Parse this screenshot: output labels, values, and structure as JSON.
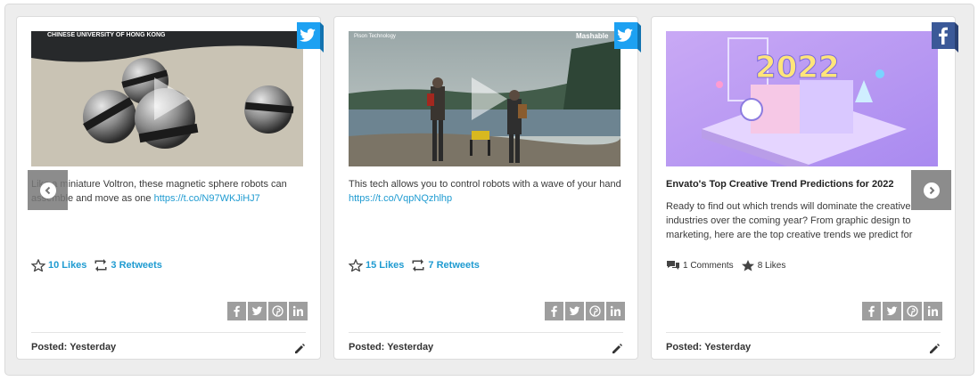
{
  "colors": {
    "link": "#1f9bd1",
    "twitter": "#1da1f2",
    "facebook": "#3b5998",
    "share_bg": "#9e9e9e"
  },
  "cards": [
    {
      "network": "twitter",
      "media_caption": "CHINESE UNIVERSITY OF HONG KONG",
      "text": "Like a miniature Voltron, these magnetic sphere robots can assemble and move as one",
      "link": "https://t.co/N97WKJiHJ7",
      "likes": "10 Likes",
      "retweets": "3 Retweets",
      "posted": "Posted: Yesterday"
    },
    {
      "network": "twitter",
      "media_caption_left": "Pison Technology",
      "media_caption_right": "Mashable",
      "text": "This tech allows you to control robots with a wave of your hand",
      "link": "https://t.co/VqpNQzhlhp",
      "likes": "15 Likes",
      "retweets": "7 Retweets",
      "posted": "Posted: Yesterday"
    },
    {
      "network": "facebook",
      "image_text": "2022",
      "headline": "Envato's Top Creative Trend Predictions for 2022",
      "text": "Ready to find out which trends will dominate the creative industries over the coming year? From graphic design to marketing, here are the top creative trends we predict for",
      "comments": "1 Comments",
      "likes": "8 Likes",
      "posted": "Posted: Yesterday"
    }
  ],
  "icons": {
    "share": [
      "facebook-icon",
      "twitter-icon",
      "pinterest-icon",
      "linkedin-icon"
    ],
    "prev": "chevron-left-icon",
    "next": "chevron-right-icon"
  }
}
